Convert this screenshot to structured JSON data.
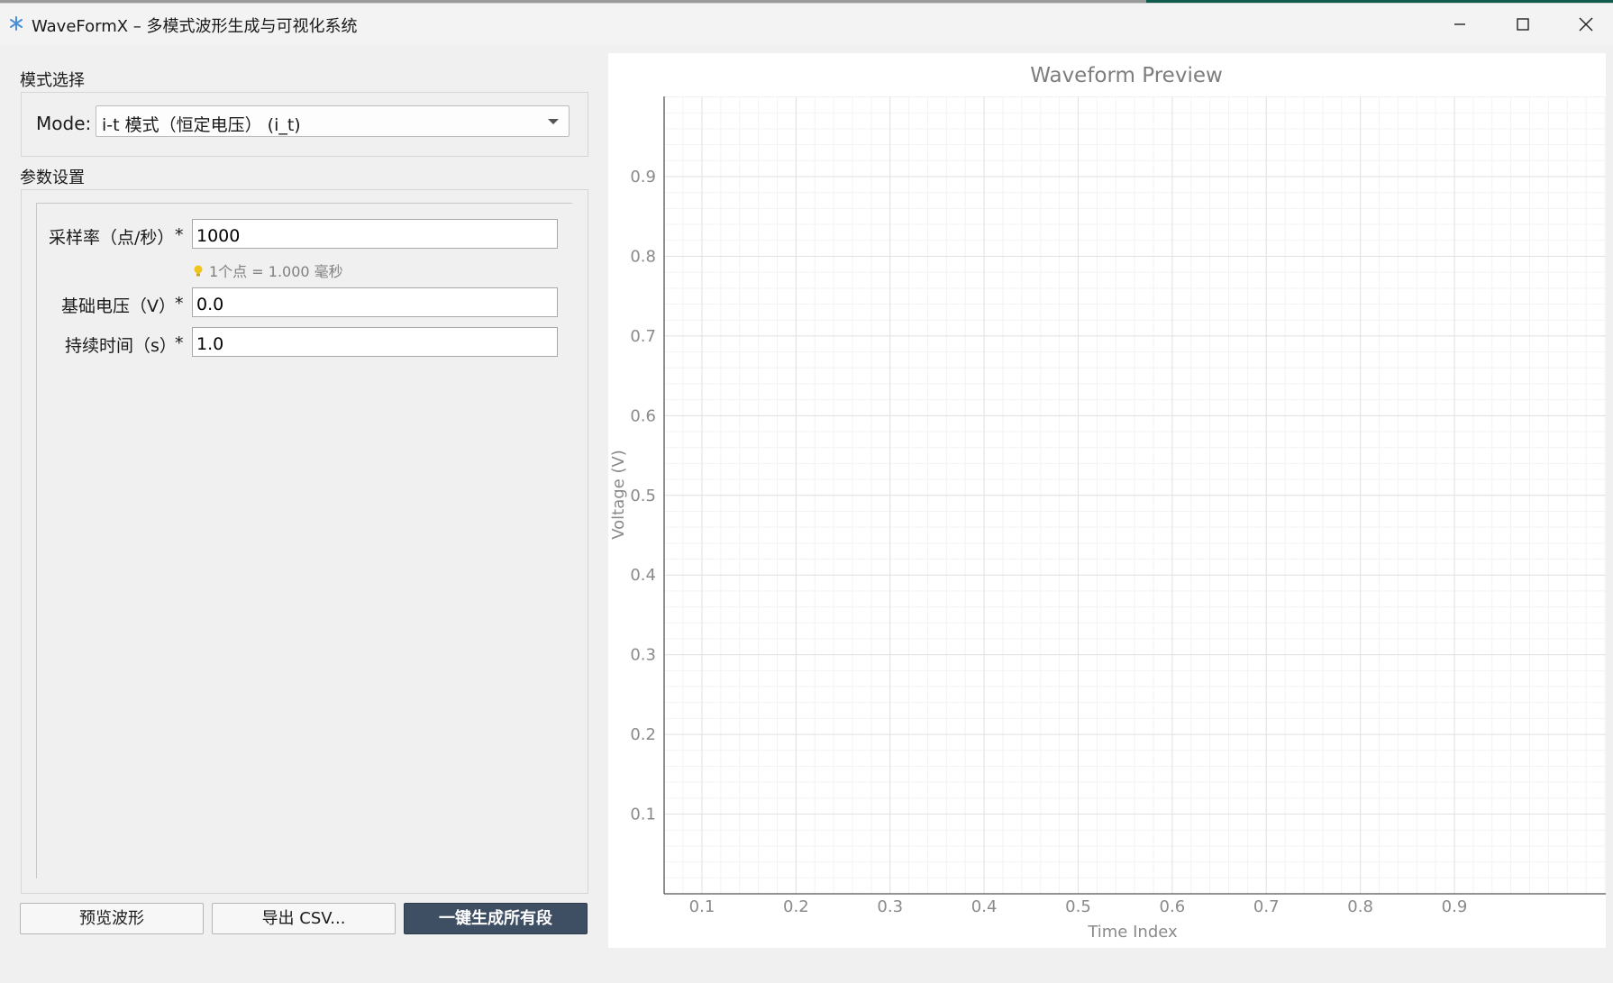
{
  "window": {
    "title": "WaveFormX – 多模式波形生成与可视化系统"
  },
  "mode_group": {
    "title": "模式选择",
    "mode_label": "Mode:",
    "selected_mode": "i-t 模式（恒定电压） (i_t)"
  },
  "params_group": {
    "title": "参数设置",
    "fields": [
      {
        "label": "采样率（点/秒）",
        "required": "*",
        "value": "1000"
      },
      {
        "label": "基础电压（V）",
        "required": "*",
        "value": "0.0"
      },
      {
        "label": "持续时间（s）",
        "required": "*",
        "value": "1.0"
      }
    ],
    "sample_hint": "1个点 = 1.000 毫秒"
  },
  "buttons": {
    "preview": "预览波形",
    "export": "导出 CSV...",
    "generate_all": "一键生成所有段"
  },
  "chart_data": {
    "type": "line",
    "title": "Waveform Preview",
    "xlabel": "Time Index",
    "ylabel": "Voltage (V)",
    "xlim": [
      0,
      1
    ],
    "ylim": [
      0,
      1
    ],
    "x_ticks": [
      "0.1",
      "0.2",
      "0.3",
      "0.4",
      "0.5",
      "0.6",
      "0.7",
      "0.8",
      "0.9"
    ],
    "y_ticks": [
      "0.1",
      "0.2",
      "0.3",
      "0.4",
      "0.5",
      "0.6",
      "0.7",
      "0.8",
      "0.9"
    ],
    "series": [],
    "grid": true
  },
  "colors": {
    "primary_button": "#3e4e63",
    "app_icon": "#4a8fd8",
    "hint_bulb": "#f0c419"
  },
  "icons": {
    "app": "app-icon",
    "minimize": "minimize-icon",
    "maximize": "maximize-icon",
    "close": "close-icon",
    "dropdown": "chevron-down-icon",
    "hint": "bulb-icon"
  }
}
